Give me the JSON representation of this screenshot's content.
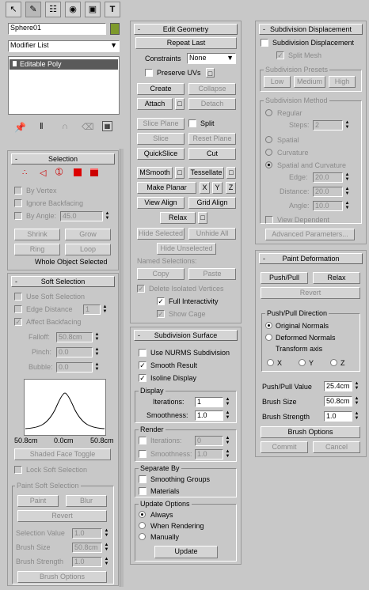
{
  "object_name": "Sphere01",
  "object_color": "#7e9a2c",
  "modifier_list": "Modifier List",
  "stack_item": "Editable Poly",
  "selection": {
    "title": "Selection",
    "by_vertex": "By Vertex",
    "ignore_backfacing": "Ignore Backfacing",
    "by_angle": "By Angle:",
    "by_angle_value": "45.0",
    "shrink": "Shrink",
    "grow": "Grow",
    "ring": "Ring",
    "loop": "Loop",
    "status": "Whole Object Selected"
  },
  "soft_selection": {
    "title": "Soft Selection",
    "use_soft": "Use Soft Selection",
    "edge_distance": "Edge Distance",
    "edge_distance_value": "1",
    "affect_backfacing": "Affect Backfacing",
    "falloff_label": "Falloff:",
    "falloff_value": "50.8cm",
    "pinch_label": "Pinch:",
    "pinch_value": "0.0",
    "bubble_label": "Bubble:",
    "bubble_value": "0.0",
    "curve_left": "50.8cm",
    "curve_mid": "0.0cm",
    "curve_right": "50.8cm",
    "shaded_face_toggle": "Shaded Face Toggle",
    "lock_soft": "Lock Soft Selection",
    "paint_group": "Paint Soft Selection",
    "paint": "Paint",
    "blur": "Blur",
    "revert": "Revert",
    "selection_value_label": "Selection Value",
    "selection_value": "1.0",
    "brush_size_label": "Brush Size",
    "brush_size": "50.8cm",
    "brush_strength_label": "Brush Strength",
    "brush_strength": "1.0",
    "brush_options": "Brush Options"
  },
  "edit_geometry": {
    "title": "Edit Geometry",
    "repeat_last": "Repeat Last",
    "constraints_label": "Constraints",
    "constraints_value": "None",
    "preserve_uvs": "Preserve UVs",
    "create": "Create",
    "collapse": "Collapse",
    "attach": "Attach",
    "detach": "Detach",
    "slice_plane": "Slice Plane",
    "split": "Split",
    "slice": "Slice",
    "reset_plane": "Reset Plane",
    "quickslice": "QuickSlice",
    "cut": "Cut",
    "msmooth": "MSmooth",
    "tessellate": "Tessellate",
    "make_planar": "Make Planar",
    "x": "X",
    "y": "Y",
    "z": "Z",
    "view_align": "View Align",
    "grid_align": "Grid Align",
    "relax": "Relax",
    "hide_selected": "Hide Selected",
    "unhide_all": "Unhide All",
    "hide_unselected": "Hide Unselected",
    "named_selections": "Named Selections:",
    "copy": "Copy",
    "paste": "Paste",
    "delete_isolated": "Delete Isolated Vertices",
    "full_interactivity": "Full Interactivity",
    "show_cage": "Show Cage"
  },
  "subdivision_surface": {
    "title": "Subdivision Surface",
    "use_nurms": "Use NURMS Subdivision",
    "smooth_result": "Smooth Result",
    "isoline_display": "Isoline Display",
    "display_group": "Display",
    "iterations_label": "Iterations:",
    "iterations_value": "1",
    "smoothness_label": "Smoothness:",
    "smoothness_value": "1.0",
    "render_group": "Render",
    "render_iterations_value": "0",
    "render_smoothness_value": "1.0",
    "separate_group": "Separate By",
    "smoothing_groups": "Smoothing Groups",
    "materials": "Materials",
    "update_group": "Update Options",
    "always": "Always",
    "when_rendering": "When Rendering",
    "manually": "Manually",
    "update": "Update"
  },
  "subdivision_displacement": {
    "title": "Subdivision Displacement",
    "sub_disp": "Subdivision Displacement",
    "split_mesh": "Split Mesh",
    "presets_group": "Subdivision Presets",
    "low": "Low",
    "medium": "Medium",
    "high": "High",
    "method_group": "Subdivision Method",
    "regular": "Regular",
    "steps_label": "Steps:",
    "steps_value": "2",
    "spatial": "Spatial",
    "curvature": "Curvature",
    "spatial_curvature": "Spatial and Curvature",
    "edge_label": "Edge:",
    "edge_value": "20.0",
    "distance_label": "Distance:",
    "distance_value": "20.0",
    "angle_label": "Angle:",
    "angle_value": "10.0",
    "view_dependent": "View Dependent",
    "advanced": "Advanced Parameters..."
  },
  "paint_deformation": {
    "title": "Paint Deformation",
    "push_pull": "Push/Pull",
    "relax": "Relax",
    "revert": "Revert",
    "direction_group": "Push/Pull Direction",
    "original_normals": "Original Normals",
    "deformed_normals": "Deformed Normals",
    "transform_axis": "Transform axis",
    "x": "X",
    "y": "Y",
    "z": "Z",
    "push_pull_value_label": "Push/Pull Value",
    "push_pull_value": "25.4cm",
    "brush_size_label": "Brush Size",
    "brush_size_value": "50.8cm",
    "brush_strength_label": "Brush Strength",
    "brush_strength_value": "1.0",
    "brush_options": "Brush Options",
    "commit": "Commit",
    "cancel": "Cancel"
  }
}
